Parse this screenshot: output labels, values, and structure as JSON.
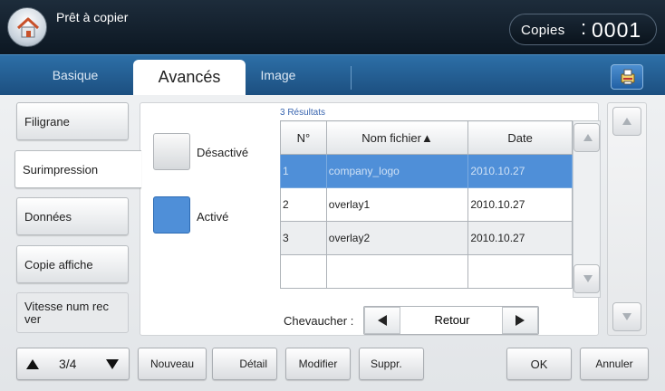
{
  "header": {
    "status": "Prêt à copier",
    "copies_label": "Copies",
    "copies_colon": ":",
    "copies_value": "0001"
  },
  "tabs": [
    {
      "label": "Basique"
    },
    {
      "label": "Avancés",
      "active": true
    },
    {
      "label": "Image"
    }
  ],
  "sidebar": {
    "items": [
      {
        "label": "Filigrane"
      },
      {
        "label": "Surimpression",
        "active": true
      },
      {
        "label": "Données"
      },
      {
        "label": "Copie affiche"
      },
      {
        "label": "Vitesse num rec ver"
      }
    ]
  },
  "options": {
    "deactivated_label": "Désactivé",
    "activated_label": "Activé",
    "selected": "Activé"
  },
  "results": {
    "count_label": "3 Résultats",
    "columns": [
      "N°",
      "Nom fichier▲",
      "Date"
    ],
    "rows": [
      {
        "num": "1",
        "name": "company_logo",
        "date": "2010.10.27",
        "selected": true
      },
      {
        "num": "2",
        "name": "overlay1",
        "date": "2010.10.27"
      },
      {
        "num": "3",
        "name": "overlay2",
        "date": "2010.10.27"
      }
    ]
  },
  "overlap": {
    "label": "Chevaucher :",
    "value": "Retour"
  },
  "bottom": {
    "page": "3/4",
    "new": "Nouveau",
    "detail": "Détail",
    "modify": "Modifier",
    "delete": "Suppr.",
    "ok": "OK",
    "cancel": "Annuler"
  },
  "colors": {
    "accent": "#4f8fd8",
    "tabbar": "#2d6fa7",
    "header": "#1d2c3b"
  },
  "icons": [
    "home-icon",
    "copy-settings-icon",
    "arrow-up-icon",
    "arrow-down-icon",
    "arrow-left-icon",
    "arrow-right-icon"
  ]
}
